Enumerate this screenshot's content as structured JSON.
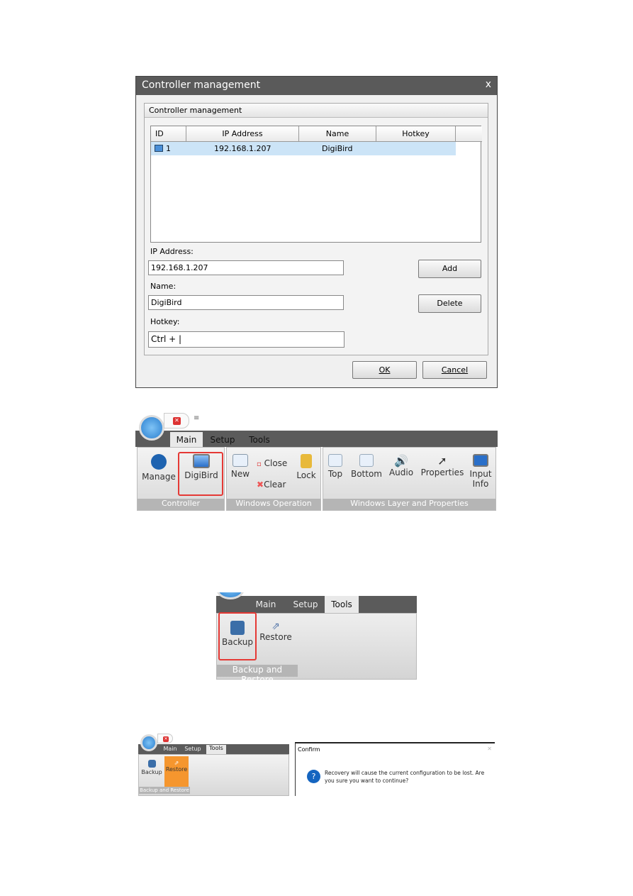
{
  "dialog": {
    "title": "Controller management",
    "close": "x",
    "group_title": "Controller management",
    "columns": [
      "ID",
      "IP Address",
      "Name",
      "Hotkey"
    ],
    "rows": [
      {
        "id": "1",
        "ip": "192.168.1.207",
        "name": "DigiBird",
        "hotkey": ""
      }
    ],
    "ip_label": "IP Address:",
    "ip_value": "192.168.1.207",
    "name_label": "Name:",
    "name_value": "DigiBird",
    "hotkey_label": "Hotkey:",
    "hotkey_value": "Ctrl + |",
    "add": "Add",
    "delete": "Delete",
    "ok": "OK",
    "cancel": "Cancel"
  },
  "ribbon1": {
    "tabs": [
      "Main",
      "Setup",
      "Tools"
    ],
    "items": {
      "manage": "Manage",
      "digibird": "DigiBird",
      "new": "New",
      "close": "Close",
      "clear": "Clear",
      "lock": "Lock",
      "top": "Top",
      "bottom": "Bottom",
      "audio": "Audio",
      "properties": "Properties",
      "input_info": "Input Info"
    },
    "groups": [
      "Controller",
      "Windows Operation",
      "Windows Layer and Properties"
    ]
  },
  "ribbon2": {
    "tabs": [
      "Main",
      "Setup",
      "Tools"
    ],
    "backup": "Backup",
    "restore": "Restore",
    "group": "Backup and Restore"
  },
  "ribbon3": {
    "tabs": [
      "Main",
      "Setup",
      "Tools"
    ],
    "backup": "Backup",
    "restore": "Restore",
    "group": "Backup and Restore"
  },
  "confirm": {
    "title": "Confirm",
    "icon": "?",
    "message": "Recovery will cause the current configuration to be lost. Are you sure you want to continue?"
  },
  "colors": {
    "highlight": "#e53935",
    "selected_row": "#cce4f7",
    "restore_active": "#f5962e",
    "question": "#1565c0"
  }
}
